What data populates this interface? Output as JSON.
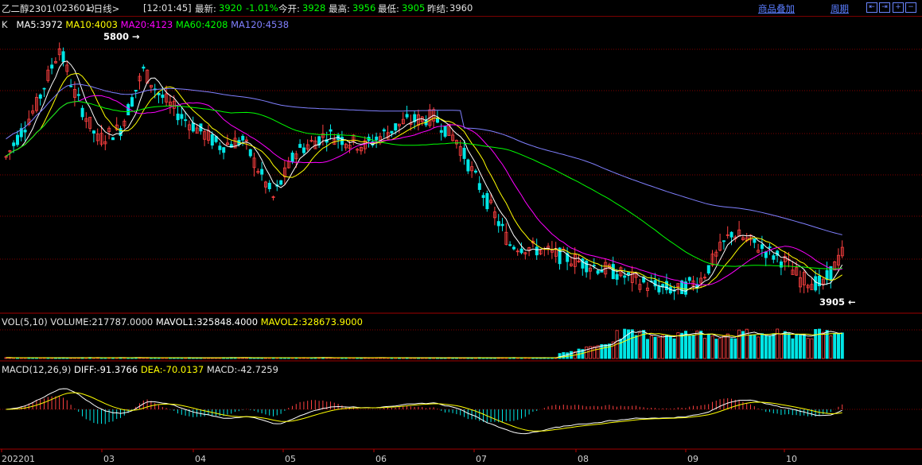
{
  "quote": {
    "name": "乙二醇2301",
    "code": "(023601)",
    "period_tag": "<日线>",
    "time": "[12:01:45]",
    "latest_label": "最新:",
    "latest": "3920",
    "change": "-1.01%",
    "open_label": "今开:",
    "open": "3928",
    "high_label": "最高:",
    "high": "3956",
    "low_label": "最低:",
    "low": "3905",
    "prev_label": "昨结:",
    "prev": "3960"
  },
  "toolbar": {
    "overlay_label": "商品叠加",
    "period_label": "周期"
  },
  "kline_legend": {
    "k": "K",
    "ma5": "MA5:3972",
    "ma10": "MA10:4003",
    "ma20": "MA20:4123",
    "ma60": "MA60:4208",
    "ma120": "MA120:4538"
  },
  "vol_legend": {
    "vol": "VOL(5,10)",
    "volume": "VOLUME:217787.0000",
    "mavol1": "MAVOL1:325848.4000",
    "mavol2": "MAVOL2:328673.9000"
  },
  "macd_legend": {
    "macd": "MACD(12,26,9)",
    "diff": "DIFF:-91.3766",
    "dea": "DEA:-70.0137",
    "macdval": "MACD:-42.7259"
  },
  "markers": {
    "high": "5800",
    "low": "3905"
  },
  "colors": {
    "up": "#ff4040",
    "down": "#00e6e6",
    "ma5": "#ffffff",
    "ma10": "#ffff00",
    "ma20": "#ff00ff",
    "ma60": "#00ff00",
    "ma120": "#8080ff",
    "grid": "#800000"
  },
  "chart_data": {
    "type": "candlestick",
    "x": [
      "202201",
      "03",
      "04",
      "05",
      "06",
      "07",
      "08",
      "09",
      "10"
    ],
    "price_high": 5800,
    "price_low": 3905,
    "last": 3920,
    "ma_latest": {
      "MA5": 3972,
      "MA10": 4003,
      "MA20": 4123,
      "MA60": 4208,
      "MA120": 4538
    },
    "volume_latest": 217787,
    "mavol1": 325848.4,
    "mavol2": 328673.9,
    "diff": -91.3766,
    "dea": -70.0137,
    "macd": -42.7259
  }
}
